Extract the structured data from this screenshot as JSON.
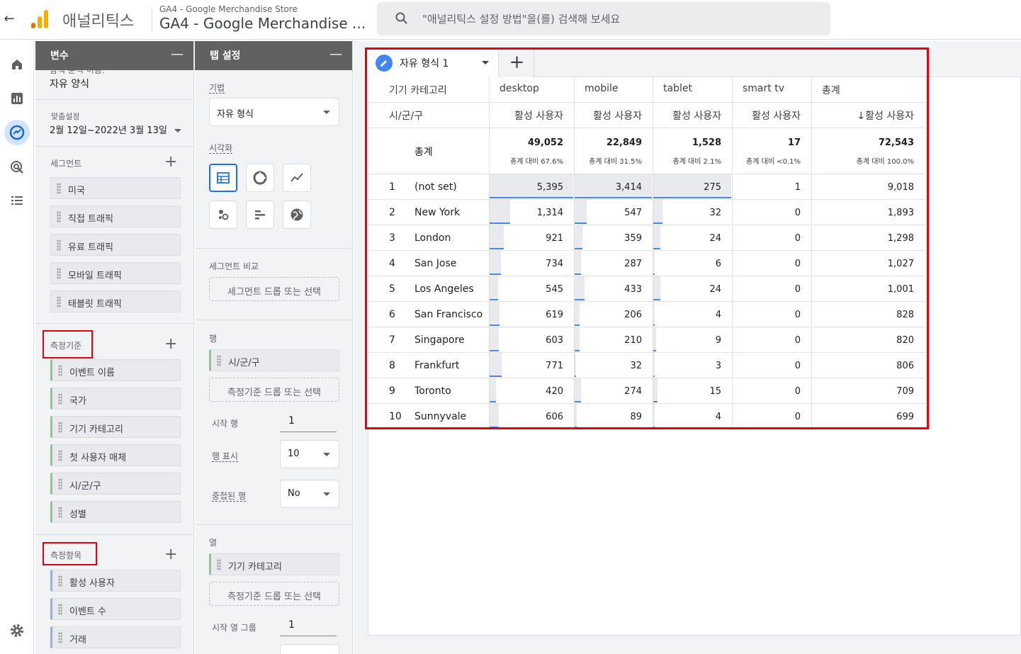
{
  "header": {
    "back_label": "←",
    "app_name": "애널리틱스",
    "account_small": "GA4 - Google Merchandise Store",
    "account_big": "GA4 - Google Merchandise ...",
    "search_placeholder": "\"애널리틱스 설정 방법\"을(를) 검색해 보세요"
  },
  "rail": [
    "home-icon",
    "reports-icon",
    "explore-icon",
    "advertising-icon",
    "configure-icon",
    "settings-icon"
  ],
  "variables_panel": {
    "title": "변수",
    "minimize": "—",
    "partial_label": "탐색 분석 이름:",
    "exploration_name": "자유 양식",
    "date_label": "맞춤설정",
    "date_range": "2월 12일~2022년 3월 13일",
    "segments_label": "세그먼트",
    "segments": [
      "미국",
      "직접 트래픽",
      "유료 트래픽",
      "모바일 트래픽",
      "태블릿 트래픽"
    ],
    "dimensions_label": "측정기준",
    "dimensions": [
      "이벤트 이름",
      "국가",
      "기기 카테고리",
      "첫 사용자 매체",
      "시/군/구",
      "성별"
    ],
    "metrics_label": "측정항목",
    "metrics": [
      "활성 사용자",
      "이벤트 수",
      "거래"
    ]
  },
  "tab_panel": {
    "title": "탭 설정",
    "minimize": "—",
    "technique_label": "기법",
    "technique_value": "자유 형식",
    "visualization_label": "시각화",
    "segment_compare_label": "세그먼트 비교",
    "segment_drop": "세그먼트 드롭 또는 선택",
    "rows_label": "행",
    "rows_chip": "시/군/구",
    "rows_drop": "측정기준 드롭 또는 선택",
    "start_row_label": "시작 행",
    "start_row_value": "1",
    "show_rows_label": "행 표시",
    "show_rows_value": "10",
    "nested_rows_label": "중첩된 행",
    "nested_rows_value": "No",
    "columns_label": "열",
    "columns_chip": "기기 카테고리",
    "columns_drop": "측정기준 드롭 또는 선택",
    "start_col_group_label": "시작 열 그룹",
    "start_col_group_value": "1"
  },
  "tabs": {
    "active_label": "자유 형식 1",
    "add_label": "+"
  },
  "table": {
    "row_dim_label": "기기 카테고리",
    "city_label": "시/군/구",
    "total_label": "총계",
    "columns": [
      {
        "name": "desktop",
        "metric": "활성 사용자",
        "total": "49,052",
        "share": "총계 대비 67.6%"
      },
      {
        "name": "mobile",
        "metric": "활성 사용자",
        "total": "22,849",
        "share": "총계 대비 31.5%"
      },
      {
        "name": "tablet",
        "metric": "활성 사용자",
        "total": "1,528",
        "share": "총계 대비 2.1%"
      },
      {
        "name": "smart tv",
        "metric": "활성 사용자",
        "total": "17",
        "share": "총계 대비 <0.1%"
      },
      {
        "name": "총계",
        "metric": "↓활성 사용자",
        "total": "72,543",
        "share": "총계 대비 100.0%"
      }
    ],
    "rows": [
      {
        "n": "1",
        "city": "(not set)",
        "v": [
          "5,395",
          "3,414",
          "275",
          "1",
          "9,018"
        ]
      },
      {
        "n": "2",
        "city": "New York",
        "v": [
          "1,314",
          "547",
          "32",
          "0",
          "1,893"
        ]
      },
      {
        "n": "3",
        "city": "London",
        "v": [
          "921",
          "359",
          "24",
          "0",
          "1,298"
        ]
      },
      {
        "n": "4",
        "city": "San Jose",
        "v": [
          "734",
          "287",
          "6",
          "0",
          "1,027"
        ]
      },
      {
        "n": "5",
        "city": "Los Angeles",
        "v": [
          "545",
          "433",
          "24",
          "0",
          "1,001"
        ]
      },
      {
        "n": "6",
        "city": "San Francisco",
        "v": [
          "619",
          "206",
          "4",
          "0",
          "828"
        ]
      },
      {
        "n": "7",
        "city": "Singapore",
        "v": [
          "603",
          "210",
          "9",
          "0",
          "820"
        ]
      },
      {
        "n": "8",
        "city": "Frankfurt",
        "v": [
          "771",
          "32",
          "3",
          "0",
          "806"
        ]
      },
      {
        "n": "9",
        "city": "Toronto",
        "v": [
          "420",
          "274",
          "15",
          "0",
          "709"
        ]
      },
      {
        "n": "10",
        "city": "Sunnyvale",
        "v": [
          "606",
          "89",
          "4",
          "0",
          "699"
        ]
      }
    ]
  }
}
